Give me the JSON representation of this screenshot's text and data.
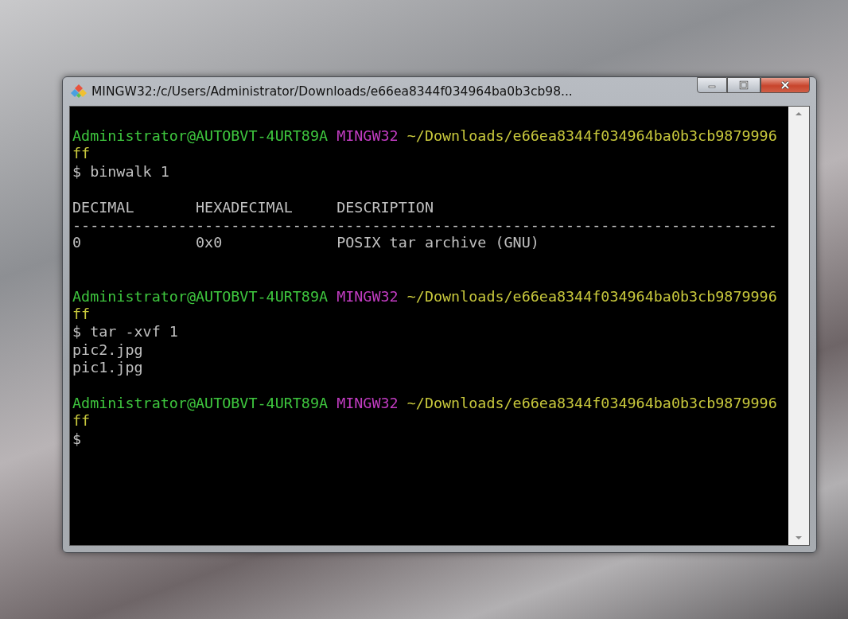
{
  "window": {
    "title": "MINGW32:/c/Users/Administrator/Downloads/e66ea8344f034964ba0b3cb98..."
  },
  "terminal": {
    "lines": [
      {
        "kind": "text",
        "segments": [
          {
            "kind": "user",
            "text": "Administrator@AUTOBVT-4URT89A"
          },
          {
            "kind": "env",
            "text": "MINGW32"
          },
          {
            "kind": "path",
            "text": "~/Downloads/e66ea8344f034964ba0b3cb9879996"
          }
        ]
      },
      {
        "kind": "text",
        "segments": [
          {
            "kind": "path",
            "text": "ff"
          }
        ]
      },
      {
        "kind": "text",
        "segments": [
          {
            "kind": "plain",
            "text": "$ binwalk 1"
          }
        ]
      },
      {
        "kind": "blank"
      },
      {
        "kind": "text",
        "segments": [
          {
            "kind": "plain",
            "text": "DECIMAL       HEXADECIMAL     DESCRIPTION"
          }
        ]
      },
      {
        "kind": "text",
        "segments": [
          {
            "kind": "plain",
            "text": "--------------------------------------------------------------------------------"
          }
        ]
      },
      {
        "kind": "text",
        "segments": [
          {
            "kind": "plain",
            "text": "0             0x0             POSIX tar archive (GNU)"
          }
        ]
      },
      {
        "kind": "blank"
      },
      {
        "kind": "blank"
      },
      {
        "kind": "text",
        "segments": [
          {
            "kind": "user",
            "text": "Administrator@AUTOBVT-4URT89A"
          },
          {
            "kind": "env",
            "text": "MINGW32"
          },
          {
            "kind": "path",
            "text": "~/Downloads/e66ea8344f034964ba0b3cb9879996"
          }
        ]
      },
      {
        "kind": "text",
        "segments": [
          {
            "kind": "path",
            "text": "ff"
          }
        ]
      },
      {
        "kind": "text",
        "segments": [
          {
            "kind": "plain",
            "text": "$ tar -xvf 1"
          }
        ]
      },
      {
        "kind": "text",
        "segments": [
          {
            "kind": "plain",
            "text": "pic2.jpg"
          }
        ]
      },
      {
        "kind": "text",
        "segments": [
          {
            "kind": "plain",
            "text": "pic1.jpg"
          }
        ]
      },
      {
        "kind": "blank"
      },
      {
        "kind": "text",
        "segments": [
          {
            "kind": "user",
            "text": "Administrator@AUTOBVT-4URT89A"
          },
          {
            "kind": "env",
            "text": "MINGW32"
          },
          {
            "kind": "path",
            "text": "~/Downloads/e66ea8344f034964ba0b3cb9879996"
          }
        ]
      },
      {
        "kind": "text",
        "segments": [
          {
            "kind": "path",
            "text": "ff"
          }
        ]
      },
      {
        "kind": "text",
        "segments": [
          {
            "kind": "plain",
            "text": "$"
          }
        ]
      }
    ]
  }
}
